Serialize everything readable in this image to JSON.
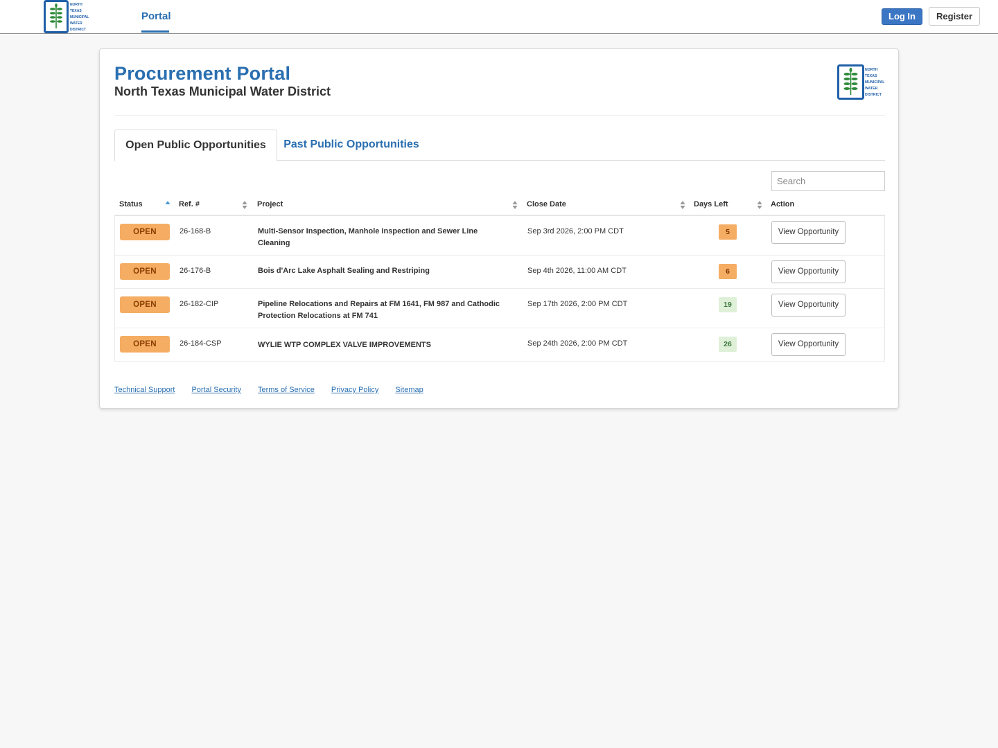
{
  "nav": {
    "portal_label": "Portal",
    "login_label": "Log In",
    "register_label": "Register",
    "logo_text": [
      "NORTH",
      "TEXAS",
      "MUNICIPAL",
      "WATER",
      "DISTRICT"
    ]
  },
  "header": {
    "title": "Procurement Portal",
    "subtitle": "North Texas Municipal Water District"
  },
  "tabs": [
    {
      "label": "Open Public Opportunities",
      "active": true
    },
    {
      "label": "Past Public Opportunities",
      "active": false
    }
  ],
  "search": {
    "placeholder": "Search",
    "value": ""
  },
  "table": {
    "columns": [
      "Status",
      "Ref. #",
      "Project",
      "Close Date",
      "Days Left",
      "Action"
    ],
    "rows": [
      {
        "status": "OPEN",
        "ref": "26-168-B",
        "project": "Multi-Sensor Inspection, Manhole Inspection and Sewer Line Cleaning",
        "close_date": "Sep 3rd 2026, 2:00 PM CDT",
        "days_left": "5",
        "action": "View Opportunity"
      },
      {
        "status": "OPEN",
        "ref": "26-176-B",
        "project": "Bois d'Arc Lake Asphalt Sealing and Restriping",
        "close_date": "Sep 4th 2026, 11:00 AM CDT",
        "days_left": "6",
        "action": "View Opportunity"
      },
      {
        "status": "OPEN",
        "ref": "26-182-CIP",
        "project": "Pipeline Relocations and Repairs at FM 1641, FM 987 and Cathodic Protection Relocations at FM 741",
        "close_date": "Sep 17th 2026, 2:00 PM CDT",
        "days_left": "19",
        "action": "View Opportunity"
      },
      {
        "status": "OPEN",
        "ref": "26-184-CSP",
        "project": "WYLIE WTP COMPLEX VALVE IMPROVEMENTS",
        "close_date": "Sep 24th 2026, 2:00 PM CDT",
        "days_left": "26",
        "action": "View Opportunity"
      }
    ]
  },
  "footer": {
    "links": [
      "Technical Support",
      "Portal Security",
      "Terms of Service",
      "Privacy Policy",
      "Sitemap"
    ]
  },
  "colors": {
    "brand_blue": "#2a6fb0",
    "login_blue": "#3a76c4",
    "status_orange": "#f5ad63",
    "days_green_bg": "#dff0d8",
    "days_green_text": "#3c763d"
  }
}
